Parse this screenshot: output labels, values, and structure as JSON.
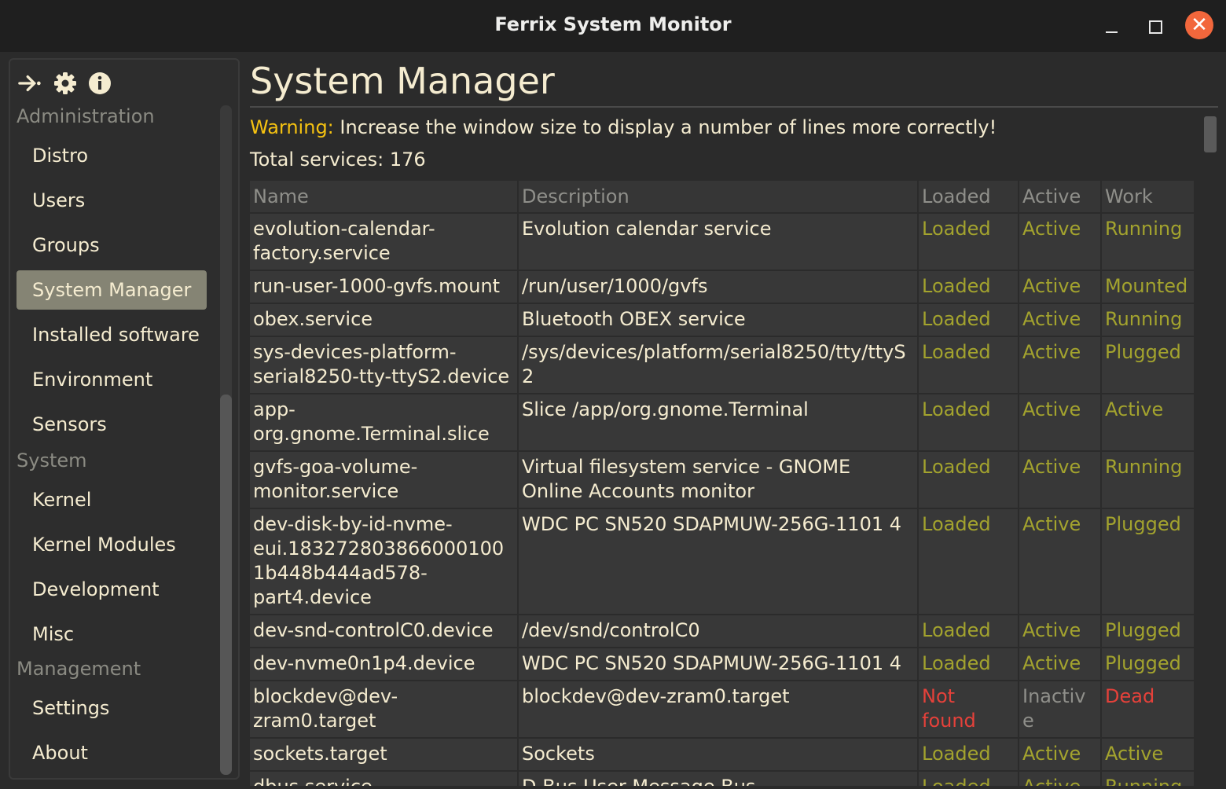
{
  "window": {
    "title": "Ferrix System Monitor",
    "close_glyph": "✕"
  },
  "sidebar": {
    "tools": [
      {
        "icon": "collapse-sidebar-icon"
      },
      {
        "icon": "gear-icon"
      },
      {
        "icon": "info-icon"
      }
    ],
    "groups": [
      {
        "label": "Administration",
        "items": [
          "Distro",
          "Users",
          "Groups",
          "System Manager",
          "Installed software",
          "Environment",
          "Sensors"
        ]
      },
      {
        "label": "System",
        "items": [
          "Kernel",
          "Kernel Modules",
          "Development",
          "Misc"
        ]
      },
      {
        "label": "Management",
        "items": [
          "Settings",
          "About"
        ]
      }
    ],
    "active_item": "System Manager"
  },
  "main": {
    "title": "System Manager",
    "warning_label": "Warning:",
    "warning_text": "Increase the window size to display a number of lines more correctly!",
    "total_label": "Total services: 176",
    "table": {
      "headers": [
        "Name",
        "Description",
        "Loaded",
        "Active",
        "Work"
      ],
      "rows": [
        [
          "evolution-calendar-factory.service",
          "Evolution calendar service",
          "Loaded",
          "Active",
          "Running"
        ],
        [
          "run-user-1000-gvfs.mount",
          "/run/user/1000/gvfs",
          "Loaded",
          "Active",
          "Mounted"
        ],
        [
          "obex.service",
          "Bluetooth OBEX service",
          "Loaded",
          "Active",
          "Running"
        ],
        [
          "sys-devices-platform-serial8250-tty-ttyS2.device",
          "/sys/devices/platform/serial8250/tty/ttyS2",
          "Loaded",
          "Active",
          "Plugged"
        ],
        [
          "app-org.gnome.Terminal.slice",
          "Slice /app/org.gnome.Terminal",
          "Loaded",
          "Active",
          "Active"
        ],
        [
          "gvfs-goa-volume-monitor.service",
          "Virtual filesystem service - GNOME Online Accounts monitor",
          "Loaded",
          "Active",
          "Running"
        ],
        [
          "dev-disk-by-id-nvme-eui.1832728038660001001b448b444ad578-part4.device",
          "WDC PC SN520 SDAPMUW-256G-1101 4",
          "Loaded",
          "Active",
          "Plugged"
        ],
        [
          "dev-snd-controlC0.device",
          "/dev/snd/controlC0",
          "Loaded",
          "Active",
          "Plugged"
        ],
        [
          "dev-nvme0n1p4.device",
          "WDC PC SN520 SDAPMUW-256G-1101 4",
          "Loaded",
          "Active",
          "Plugged"
        ],
        [
          "blockdev@dev-zram0.target",
          "blockdev@dev-zram0.target",
          "Not found",
          "Inactive",
          "Dead"
        ],
        [
          "sockets.target",
          "Sockets",
          "Loaded",
          "Active",
          "Active"
        ],
        [
          "dbus.service",
          "D-Bus User Message Bus",
          "Loaded",
          "Active",
          "Running"
        ]
      ]
    }
  },
  "colors": {
    "ok": "#a3a32e",
    "bad": "#e5413a",
    "warning": "#f5c211",
    "text": "#f5ecd0",
    "active_bg": "#858474"
  }
}
